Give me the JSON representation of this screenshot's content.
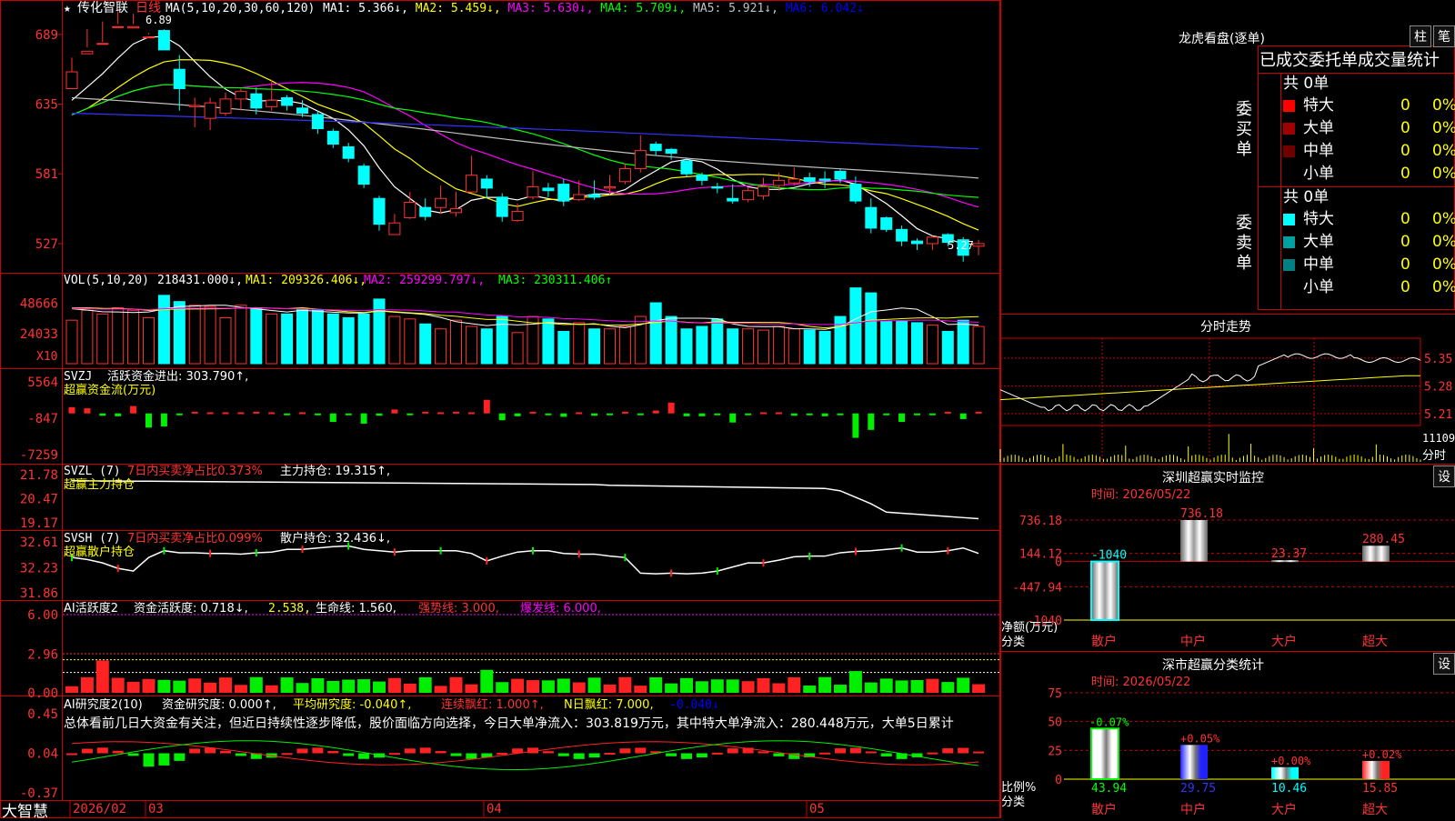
{
  "stock": {
    "star": "★",
    "name": "传化智联",
    "period": "日线",
    "peak_label": "6.89",
    "low_label": "5.27"
  },
  "candles": {
    "dates_label": [
      "2026/02",
      "03",
      "04",
      "05"
    ],
    "y_ticks": [
      "689",
      "635",
      "581",
      "527"
    ],
    "ohlc": [
      [
        6.47,
        6.6,
        6.49,
        6.71
      ],
      [
        6.74,
        6.76,
        6.79,
        6.93
      ],
      [
        6.82,
        6.82,
        6.83,
        6.99
      ],
      [
        6.95,
        6.95,
        6.97,
        7.07
      ],
      [
        6.94,
        6.95,
        6.97,
        7.05
      ],
      [
        6.87,
        6.87,
        6.9,
        6.89
      ],
      [
        6.92,
        6.77,
        6.82,
        6.93
      ],
      [
        6.62,
        6.47,
        6.3,
        6.73
      ],
      [
        6.33,
        6.34,
        6.17,
        6.4
      ],
      [
        6.24,
        6.36,
        6.15,
        6.4
      ],
      [
        6.28,
        6.39,
        6.26,
        6.44
      ],
      [
        6.39,
        6.45,
        6.3,
        6.47
      ],
      [
        6.43,
        6.32,
        6.27,
        6.48
      ],
      [
        6.33,
        6.38,
        6.3,
        6.54
      ],
      [
        6.4,
        6.34,
        6.3,
        6.42
      ],
      [
        6.32,
        6.28,
        6.25,
        6.38
      ],
      [
        6.27,
        6.16,
        6.12,
        6.3
      ],
      [
        6.14,
        6.04,
        6.01,
        6.16
      ],
      [
        6.02,
        5.93,
        5.9,
        6.05
      ],
      [
        5.87,
        5.73,
        5.7,
        5.89
      ],
      [
        5.62,
        5.42,
        5.37,
        5.64
      ],
      [
        5.34,
        5.43,
        5.34,
        5.5
      ],
      [
        5.47,
        5.59,
        5.46,
        5.67
      ],
      [
        5.55,
        5.48,
        5.45,
        5.62
      ],
      [
        5.55,
        5.62,
        5.5,
        5.72
      ],
      [
        5.51,
        5.54,
        5.48,
        5.67
      ],
      [
        5.67,
        5.8,
        5.66,
        5.95
      ],
      [
        5.77,
        5.7,
        5.62,
        5.8
      ],
      [
        5.63,
        5.48,
        5.44,
        5.66
      ],
      [
        5.45,
        5.52,
        5.44,
        5.58
      ],
      [
        5.63,
        5.71,
        5.61,
        5.83
      ],
      [
        5.7,
        5.68,
        5.63,
        5.74
      ],
      [
        5.73,
        5.6,
        5.56,
        5.77
      ],
      [
        5.61,
        5.65,
        5.6,
        5.76
      ],
      [
        5.65,
        5.63,
        5.61,
        5.76
      ],
      [
        5.7,
        5.71,
        5.65,
        5.8
      ],
      [
        5.75,
        5.85,
        5.73,
        5.89
      ],
      [
        5.85,
        5.99,
        5.82,
        6.11
      ],
      [
        6.04,
        5.99,
        5.95,
        6.06
      ],
      [
        6.0,
        5.97,
        5.92,
        6.01
      ],
      [
        5.91,
        5.81,
        5.79,
        5.93
      ],
      [
        5.8,
        5.76,
        5.72,
        5.82
      ],
      [
        5.71,
        5.7,
        5.66,
        5.74
      ],
      [
        5.62,
        5.6,
        5.58,
        5.73
      ],
      [
        5.61,
        5.68,
        5.59,
        5.71
      ],
      [
        5.64,
        5.71,
        5.61,
        5.78
      ],
      [
        5.72,
        5.76,
        5.68,
        5.82
      ],
      [
        5.74,
        5.77,
        5.72,
        5.86
      ],
      [
        5.78,
        5.75,
        5.71,
        5.82
      ],
      [
        5.77,
        5.76,
        5.7,
        5.83
      ],
      [
        5.83,
        5.77,
        5.74,
        5.85
      ],
      [
        5.73,
        5.6,
        5.58,
        5.79
      ],
      [
        5.55,
        5.39,
        5.35,
        5.62
      ],
      [
        5.47,
        5.38,
        5.36,
        5.48
      ],
      [
        5.38,
        5.29,
        5.25,
        5.41
      ],
      [
        5.29,
        5.27,
        5.22,
        5.31
      ],
      [
        5.27,
        5.32,
        5.22,
        5.33
      ],
      [
        5.34,
        5.28,
        5.25,
        5.35
      ],
      [
        5.3,
        5.18,
        5.13,
        5.32
      ],
      [
        5.25,
        5.27,
        5.18,
        5.3
      ]
    ]
  },
  "ma_bar": {
    "prefix": "MA(5,10,20,30,60,120)",
    "items": [
      {
        "label": "MA1: 5.366↓,",
        "color": "#ffffff"
      },
      {
        "label": "MA2: 5.459↓,",
        "color": "#ffff00"
      },
      {
        "label": "MA3: 5.630↓,",
        "color": "#ff00ff"
      },
      {
        "label": "MA4: 5.709↓,",
        "color": "#00ff00"
      },
      {
        "label": "MA5: 5.921↓,",
        "color": "#c0c0c0"
      },
      {
        "label": "MA6: 6.042↓",
        "color": "#0000ff"
      }
    ]
  },
  "vol": {
    "header": "VOL(5,10,20)",
    "value": "218431.000↓,",
    "ma1": "MA1: 209326.406↓,",
    "ma2": "MA2: 259299.797↓,",
    "ma3": "MA3: 230311.406↑",
    "y_ticks": [
      "48666",
      "24033"
    ],
    "unit": "X10",
    "bars": [
      35,
      43,
      40,
      45,
      43,
      37,
      55,
      50,
      47,
      46,
      37,
      47,
      44,
      40,
      40,
      44,
      43,
      40,
      37,
      40,
      52,
      38,
      36,
      32,
      28,
      35,
      30,
      28,
      38,
      25,
      38,
      36,
      26,
      33,
      28,
      28,
      30,
      38,
      49,
      38,
      28,
      30,
      36,
      28,
      28,
      27,
      30,
      28,
      27,
      26,
      38,
      61,
      57,
      34,
      34,
      33,
      31,
      26,
      35,
      30
    ]
  },
  "svzj": {
    "header": "SVZJ",
    "label": "活跃资金进出: 303.790↑,",
    "sub": "超赢资金流(万元)",
    "y_ticks": [
      "5564",
      "-847",
      "-7259"
    ],
    "values": [
      1100,
      900,
      -400,
      -500,
      1300,
      -2500,
      -2300,
      -300,
      300,
      200,
      200,
      200,
      300,
      200,
      -200,
      200,
      -200,
      -1500,
      -300,
      -1800,
      -400,
      700,
      -300,
      300,
      200,
      300,
      200,
      2400,
      -1200,
      -500,
      300,
      -200,
      -600,
      200,
      -400,
      -300,
      300,
      -300,
      500,
      1900,
      -500,
      -500,
      -300,
      -1600,
      -300,
      200,
      200,
      -400,
      -200,
      -500,
      -300,
      -4300,
      -2900,
      -300,
      -1500,
      -200,
      -300,
      300,
      -1000,
      300
    ]
  },
  "svzl": {
    "header": "SVZL (7)",
    "ratio": "7日内买卖净占比0.373%",
    "main": "主力持仓: 19.315↑,",
    "sub": "超赢主力持仓",
    "y_ticks": [
      "21.78",
      "20.47",
      "19.17"
    ]
  },
  "svsh": {
    "header": "SVSH (7)",
    "ratio": "7日内买卖净占比0.099%",
    "retail": "散户持仓: 32.436↓,",
    "sub": "超赢散户持仓",
    "y_ticks": [
      "32.61",
      "32.23",
      "31.86"
    ]
  },
  "ai1": {
    "header": "AI活跃度2",
    "a": "资金活跃度: 0.718↓,",
    "b": "2.538,",
    "c": "生命线: 1.560,",
    "d": "强势线: 3.000,",
    "e": "爆发线: 6.000,",
    "y_ticks": [
      "6.00",
      "2.96",
      "0.00"
    ]
  },
  "ai2": {
    "header": "AI研究度2(10)",
    "a": "资金研究度: 0.000↑,",
    "b": "平均研究度: -0.040↑,",
    "c": "连续飘红: 1.000↑,",
    "d": "N日飘红: 7.000,",
    "e": "-0.040↓",
    "y_ticks": [
      "0.45",
      "0.04",
      "-0.37"
    ],
    "summary": "总体看前几日大资金有关注，但近日持续性逐步降低，股价面临方向选择，今日大单净流入：303.819万元，其中特大单净流入：280.448万元，大单5日累计"
  },
  "lhb": {
    "title": "龙虎看盘(逐单)",
    "btn_zhu": "柱",
    "btn_bi": "笔",
    "header": "已成交委托单成交量统计",
    "buy": {
      "side": "委买单",
      "total": "共 0单",
      "rows": [
        {
          "name": "特大",
          "v1": "0",
          "v2": "0%",
          "color": "#ff0000"
        },
        {
          "name": "大单",
          "v1": "0",
          "v2": "0%",
          "color": "#a00000"
        },
        {
          "name": "中单",
          "v1": "0",
          "v2": "0%",
          "color": "#700000"
        },
        {
          "name": "小单",
          "v1": "0",
          "v2": "0%",
          "color": "#000000"
        }
      ]
    },
    "sell": {
      "side": "委卖单",
      "total": "共 0单",
      "rows": [
        {
          "name": "特大",
          "v1": "0",
          "v2": "0%",
          "color": "#00ffff"
        },
        {
          "name": "大单",
          "v1": "0",
          "v2": "0%",
          "color": "#00a0a0"
        },
        {
          "name": "中单",
          "v1": "0",
          "v2": "0%",
          "color": "#008080"
        },
        {
          "name": "小单",
          "v1": "0",
          "v2": "0%",
          "color": "#000000"
        }
      ]
    }
  },
  "intraday": {
    "title": "分时走势",
    "y_ticks": [
      "5.35",
      "5.28",
      "5.21"
    ],
    "vol_label": "11109",
    "fen_label": "分时"
  },
  "monitor": {
    "title": "深圳超赢实时监控",
    "btn": "设",
    "date": "时间: 2026/05/22",
    "y_ticks": [
      "736.18",
      "144.12",
      "0",
      "-447.94",
      "-1040"
    ],
    "unit": "净额(万元)",
    "cat_label": "分类",
    "categories": [
      "散户",
      "中户",
      "大户",
      "超大"
    ],
    "values": [
      -1040,
      736.18,
      23.37,
      280.45
    ],
    "labels": [
      "-1040",
      "736.18",
      "23.37",
      "280.45"
    ]
  },
  "classify": {
    "title": "深市超赢分类统计",
    "btn": "设",
    "date": "时间: 2026/05/22",
    "y_ticks": [
      "75",
      "50",
      "25",
      "0"
    ],
    "unit": "比例%",
    "cat_label": "分类",
    "categories": [
      "散户",
      "中户",
      "大户",
      "超大"
    ],
    "values": [
      43.94,
      29.75,
      10.46,
      15.85
    ],
    "value_labels": [
      "43.94",
      "29.75",
      "10.46",
      "15.85"
    ],
    "change_labels": [
      "-0.07%",
      "+0.05%",
      "+0.00%",
      "+0.02%"
    ],
    "colors": [
      "#ffffff",
      "#0000ff",
      "#00ffff",
      "#ff0000"
    ]
  },
  "footer": {
    "logo": "大智慧"
  }
}
